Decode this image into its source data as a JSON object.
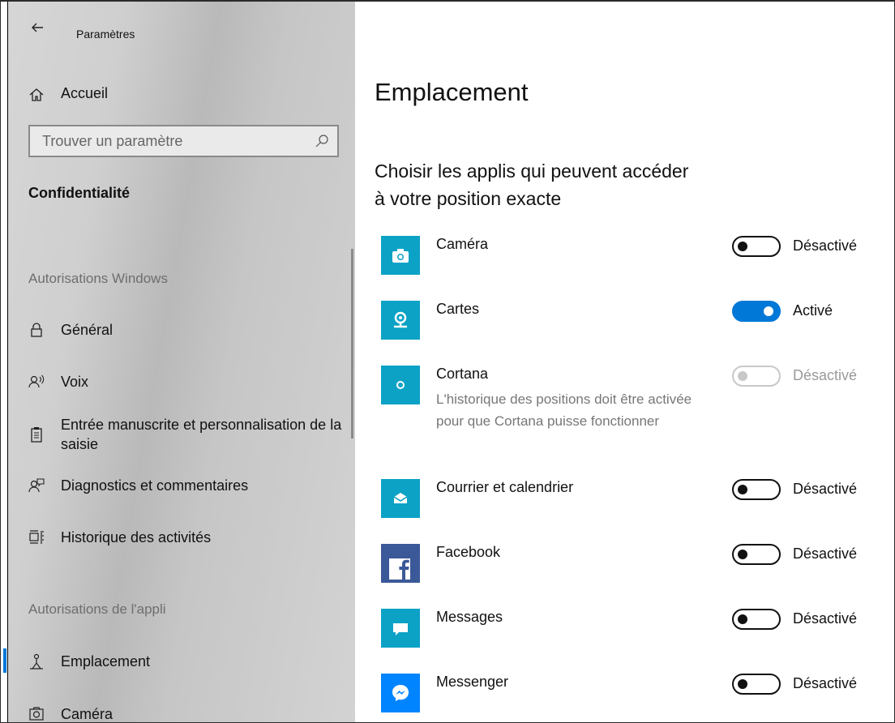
{
  "window": {
    "title": "Paramètres"
  },
  "sidebar": {
    "home_label": "Accueil",
    "search_placeholder": "Trouver un paramètre",
    "category": "Confidentialité",
    "section_windows": "Autorisations Windows",
    "section_app": "Autorisations de l'appli",
    "items": [
      {
        "label": "Général",
        "icon": "lock-icon"
      },
      {
        "label": "Voix",
        "icon": "speech-icon"
      },
      {
        "label": "Entrée manuscrite et personnalisation de la saisie",
        "icon": "clipboard-icon"
      },
      {
        "label": "Diagnostics et commentaires",
        "icon": "feedback-icon"
      },
      {
        "label": "Historique des activités",
        "icon": "timeline-icon"
      },
      {
        "label": "Emplacement",
        "icon": "location-person-icon",
        "selected": true
      },
      {
        "label": "Caméra",
        "icon": "camera-icon"
      }
    ]
  },
  "main": {
    "title": "Emplacement",
    "subtitle": "Choisir les applis qui peuvent accéder à votre position exacte",
    "apps": [
      {
        "name": "Caméra",
        "state": "Désactivé",
        "on": false,
        "disabled": false,
        "icon": "camera-app-icon",
        "color": "#0ba2c6"
      },
      {
        "name": "Cartes",
        "state": "Activé",
        "on": true,
        "disabled": false,
        "icon": "maps-app-icon",
        "color": "#0ba2c6"
      },
      {
        "name": "Cortana",
        "description": "L'historique des positions doit être activée pour que Cortana puisse fonctionner",
        "state": "Désactivé",
        "on": false,
        "disabled": true,
        "icon": "cortana-app-icon",
        "color": "#0ba2c6"
      },
      {
        "name": "Courrier et calendrier",
        "state": "Désactivé",
        "on": false,
        "disabled": false,
        "icon": "mail-app-icon",
        "color": "#0ba2c6"
      },
      {
        "name": "Facebook",
        "state": "Désactivé",
        "on": false,
        "disabled": false,
        "icon": "facebook-app-icon",
        "color": "#3b5998"
      },
      {
        "name": "Messages",
        "state": "Désactivé",
        "on": false,
        "disabled": false,
        "icon": "messages-app-icon",
        "color": "#0ba2c6"
      },
      {
        "name": "Messenger",
        "state": "Désactivé",
        "on": false,
        "disabled": false,
        "icon": "messenger-app-icon",
        "color": "#0084ff"
      }
    ]
  },
  "colors": {
    "accent": "#0078d7",
    "app_tile": "#0ba2c6",
    "facebook": "#3b5998",
    "messenger": "#0084ff"
  }
}
